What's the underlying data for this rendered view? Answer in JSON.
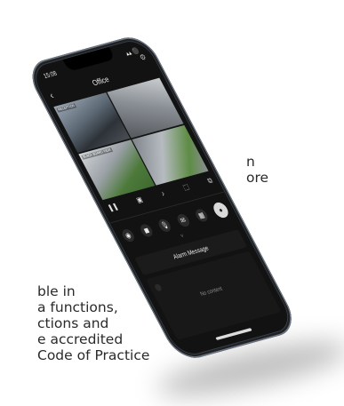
{
  "background_text": {
    "line1": "n",
    "line2": "ore",
    "line3": "ble in",
    "line4": "a functions,",
    "line5": "ctions and",
    "line6": "e accredited",
    "line7": "Code of Practice"
  },
  "status_bar": {
    "time": "15:08",
    "signal": "▴▴ ⚫"
  },
  "header": {
    "title": "Office",
    "back_icon": "‹",
    "settings_icon": "⚙"
  },
  "cameras": [
    {
      "label": "RECEPTION"
    },
    {
      "label": ""
    },
    {
      "label": "BLACK BOARD VIEW"
    },
    {
      "label": ""
    }
  ],
  "toolbar": {
    "pause": "❚❚",
    "snapshot": "▣",
    "audio": "♪",
    "record": "⬚",
    "split": "⧉"
  },
  "controls": {
    "playback": "◉",
    "camera": "◼",
    "mic": "🎙",
    "message": "✉",
    "grid": "▦",
    "big_button": "●"
  },
  "chevron": "˅",
  "alarm": {
    "label": "Alarm Message"
  },
  "list": {
    "empty": "No content"
  },
  "colors": {
    "bezel": "#3a4350",
    "screen": "#121212"
  }
}
